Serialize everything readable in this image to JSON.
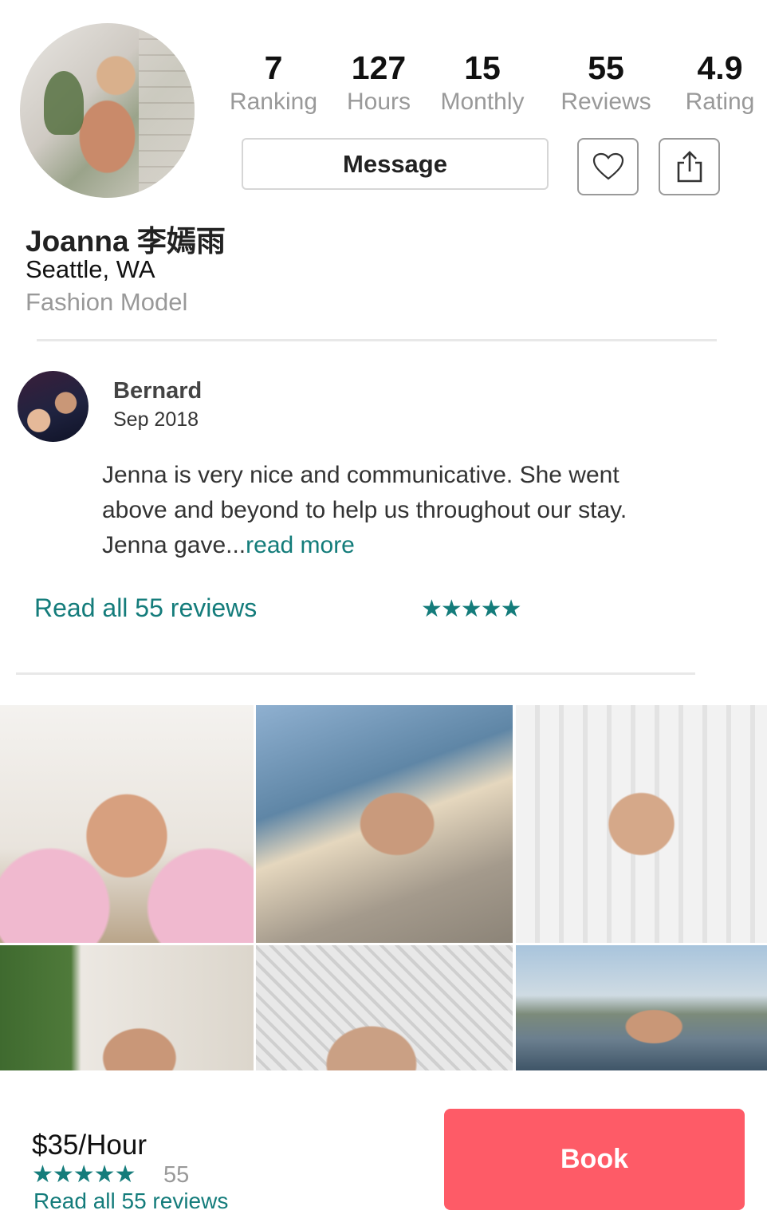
{
  "profile": {
    "name": "Joanna 李嫣雨",
    "location": "Seattle, WA",
    "profession": "Fashion Model"
  },
  "stats": [
    {
      "value": "7",
      "label": "Ranking"
    },
    {
      "value": "127",
      "label": "Hours"
    },
    {
      "value": "15",
      "label": "Monthly"
    },
    {
      "value": "55",
      "label": "Reviews"
    },
    {
      "value": "4.9",
      "label": "Rating"
    }
  ],
  "actions": {
    "message_label": "Message",
    "favorite_icon": "heart-icon",
    "share_icon": "share-icon"
  },
  "review": {
    "author": "Bernard",
    "date": "Sep 2018",
    "text": "Jenna is very nice and communicative. She went above and beyond to help us throughout our stay. Jenna gave...",
    "read_more": "read more",
    "read_all": "Read all 55 reviews",
    "stars": "★★★★★"
  },
  "booking": {
    "price": "$35/Hour",
    "stars": "★★★★★",
    "review_count": "55",
    "read_all": "Read all 55 reviews",
    "book_label": "Book"
  },
  "colors": {
    "accent_teal": "#147c7b",
    "book_button": "#fe5b67"
  }
}
